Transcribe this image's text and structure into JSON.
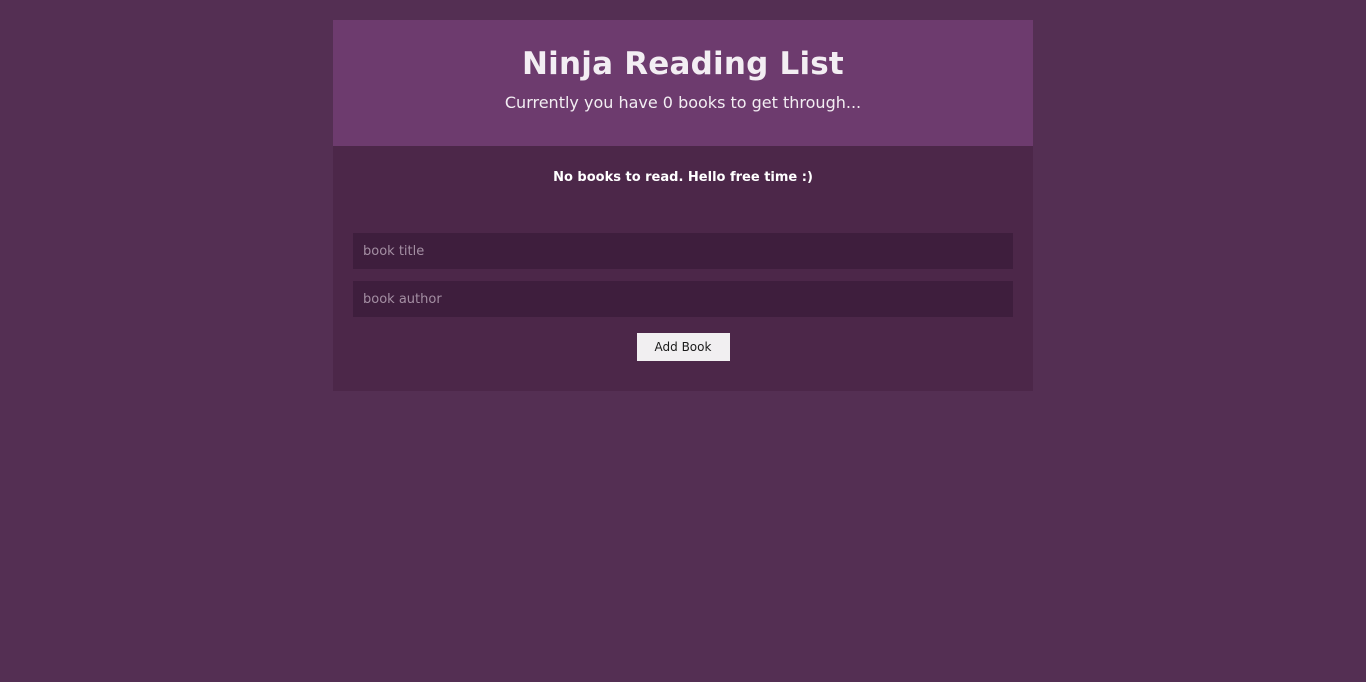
{
  "header": {
    "title": "Ninja Reading List",
    "subtitle": "Currently you have 0 books to get through..."
  },
  "book_list": {
    "empty_message": "No books to read. Hello free time :)"
  },
  "form": {
    "title_placeholder": "book title",
    "author_placeholder": "book author",
    "title_value": "",
    "author_value": "",
    "submit_label": "Add Book"
  },
  "colors": {
    "page_background": "#542f53",
    "header_background": "#6d3b6e",
    "panel_background": "#4c2749",
    "input_background": "#3e1e3d",
    "button_background": "#f1eff1"
  }
}
